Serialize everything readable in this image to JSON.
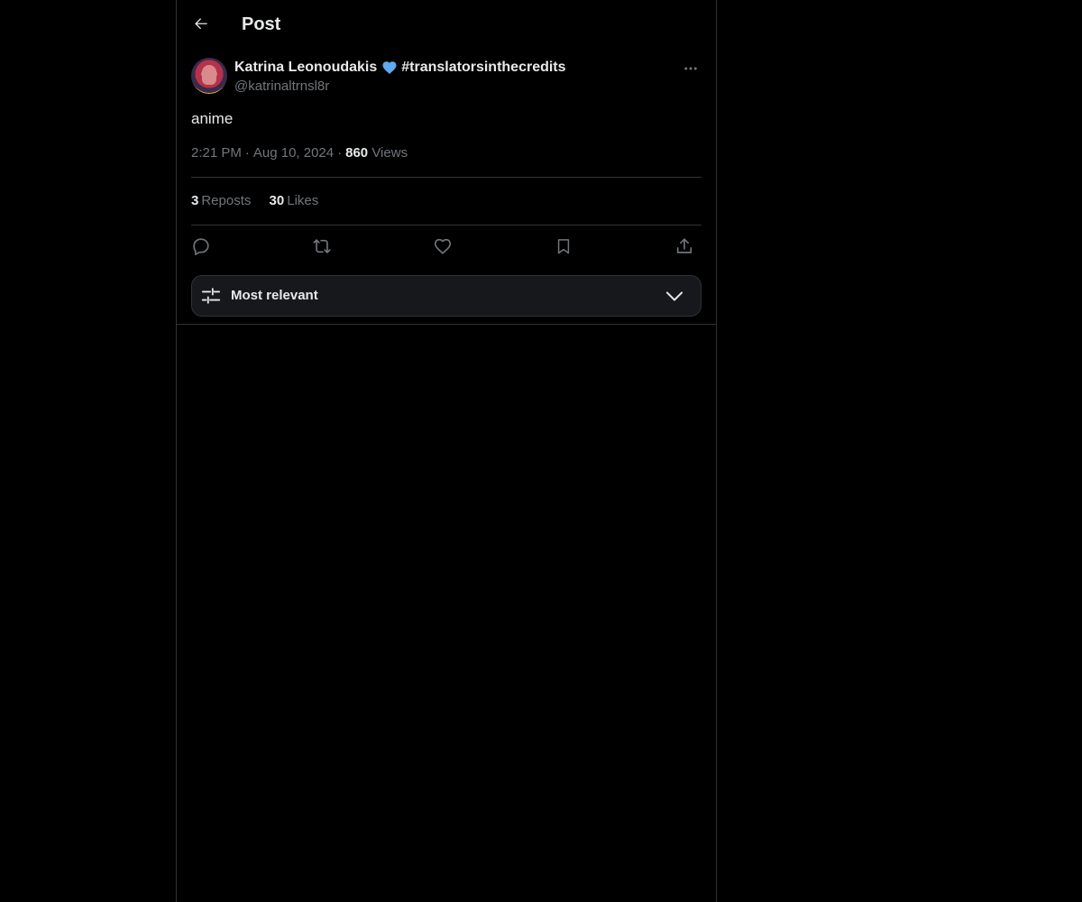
{
  "header": {
    "title": "Post"
  },
  "post": {
    "author": {
      "name": "Katrina Leonoudakis",
      "badge_emoji": "blue-heart-icon",
      "name_tag": "#translatorsinthecredits",
      "handle": "@katrinaltrnsl8r"
    },
    "text": "anime",
    "time": "2:21 PM",
    "separator": "·",
    "date": "Aug 10, 2024",
    "views_count": "860",
    "views_label": "Views",
    "reposts_count": "3",
    "reposts_label": "Reposts",
    "likes_count": "30",
    "likes_label": "Likes"
  },
  "actions": {
    "icons": [
      "reply-icon",
      "repost-icon",
      "like-icon",
      "bookmark-icon",
      "share-icon"
    ]
  },
  "sort": {
    "label": "Most relevant"
  },
  "colors": {
    "background": "#000000",
    "text_primary": "#e7e9ea",
    "text_secondary": "#71767b",
    "border": "#2f3336",
    "heart": "#5ea9f0"
  }
}
